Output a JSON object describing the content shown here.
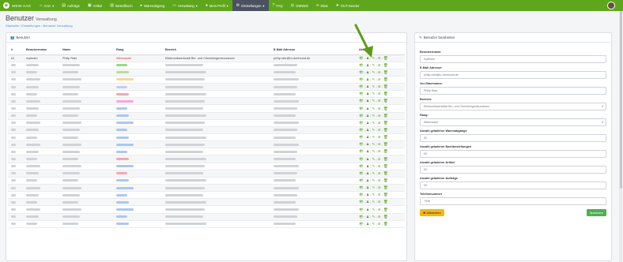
{
  "nav": {
    "brand": "WEW-AAG",
    "items": [
      {
        "label": "AAG",
        "icon": "home-icon",
        "caret": true
      },
      {
        "label": "Aufträge",
        "icon": "clipboard-icon"
      },
      {
        "label": "Artikel",
        "icon": "box-icon"
      },
      {
        "label": "Bestellbuch",
        "icon": "book-icon"
      },
      {
        "label": "Warenabgang",
        "icon": "truck-icon"
      },
      {
        "label": "Verwaltung",
        "icon": "folder-icon",
        "caret": true
      },
      {
        "label": "Mein Profil",
        "icon": "user-icon",
        "caret": true
      },
      {
        "label": "Einstellungen",
        "icon": "gear-icon",
        "caret": true,
        "active": true
      },
      {
        "label": "FAQ",
        "icon": "question-icon"
      },
      {
        "label": "OWWeb",
        "icon": "globe-icon"
      },
      {
        "label": "Sitas",
        "icon": "link-icon"
      },
      {
        "label": "GUT-Sender",
        "icon": "send-icon"
      }
    ]
  },
  "page": {
    "title": "Benutzer",
    "subtitle": "Verwaltung",
    "breadcrumb": [
      "Startseite",
      "Einstellungen",
      "Benutzer Verwaltung"
    ]
  },
  "table_card": {
    "header": "Benutzer",
    "columns": [
      "#",
      "Benutzername",
      "Name",
      "Rang",
      "Bereich",
      "E-Mail Adresse",
      "Aktion"
    ],
    "first_row": {
      "id": "#1",
      "username": "mylbrahr",
      "name": "Philip Rahr",
      "rank": "Webmaster",
      "area": "Elektronikwerkstatt Bio- und Chemieingenieurwesen",
      "email": "philip.rahr@tu-dortmund.de"
    },
    "hidden_row_count": 23,
    "colors": {
      "rank_red": "#e0303a",
      "action_green": "#4a9b18"
    }
  },
  "edit_card": {
    "header": "Benutzer bearbeiten",
    "fields": [
      {
        "label": "Benutzername:",
        "value": "mylbrahr"
      },
      {
        "label": "E-Mail Adresse:",
        "value": "philip.rahr@tu-dortmund.de"
      },
      {
        "label": "Vor-/Nachname:",
        "value": "Philip Rahr"
      },
      {
        "label": "Bereich:",
        "value": "Elektronikwerkstatt Bio- und Chemieingenieurwesen",
        "select": true
      },
      {
        "label": "Rang:",
        "value": "Webmaster",
        "select": true
      },
      {
        "label": "Anzahl geladener Warenabgänge",
        "value": "50"
      },
      {
        "label": "Anzahl geladener Nachbestellungen",
        "value": "50"
      },
      {
        "label": "Anzahl geladener Artikel",
        "value": "50"
      },
      {
        "label": "Anzahl geladener Aufträge",
        "value": "50"
      },
      {
        "label": "Telefonnummer",
        "value": "7996"
      }
    ],
    "cancel_label": "Abbrechen",
    "save_label": "Speichern"
  }
}
